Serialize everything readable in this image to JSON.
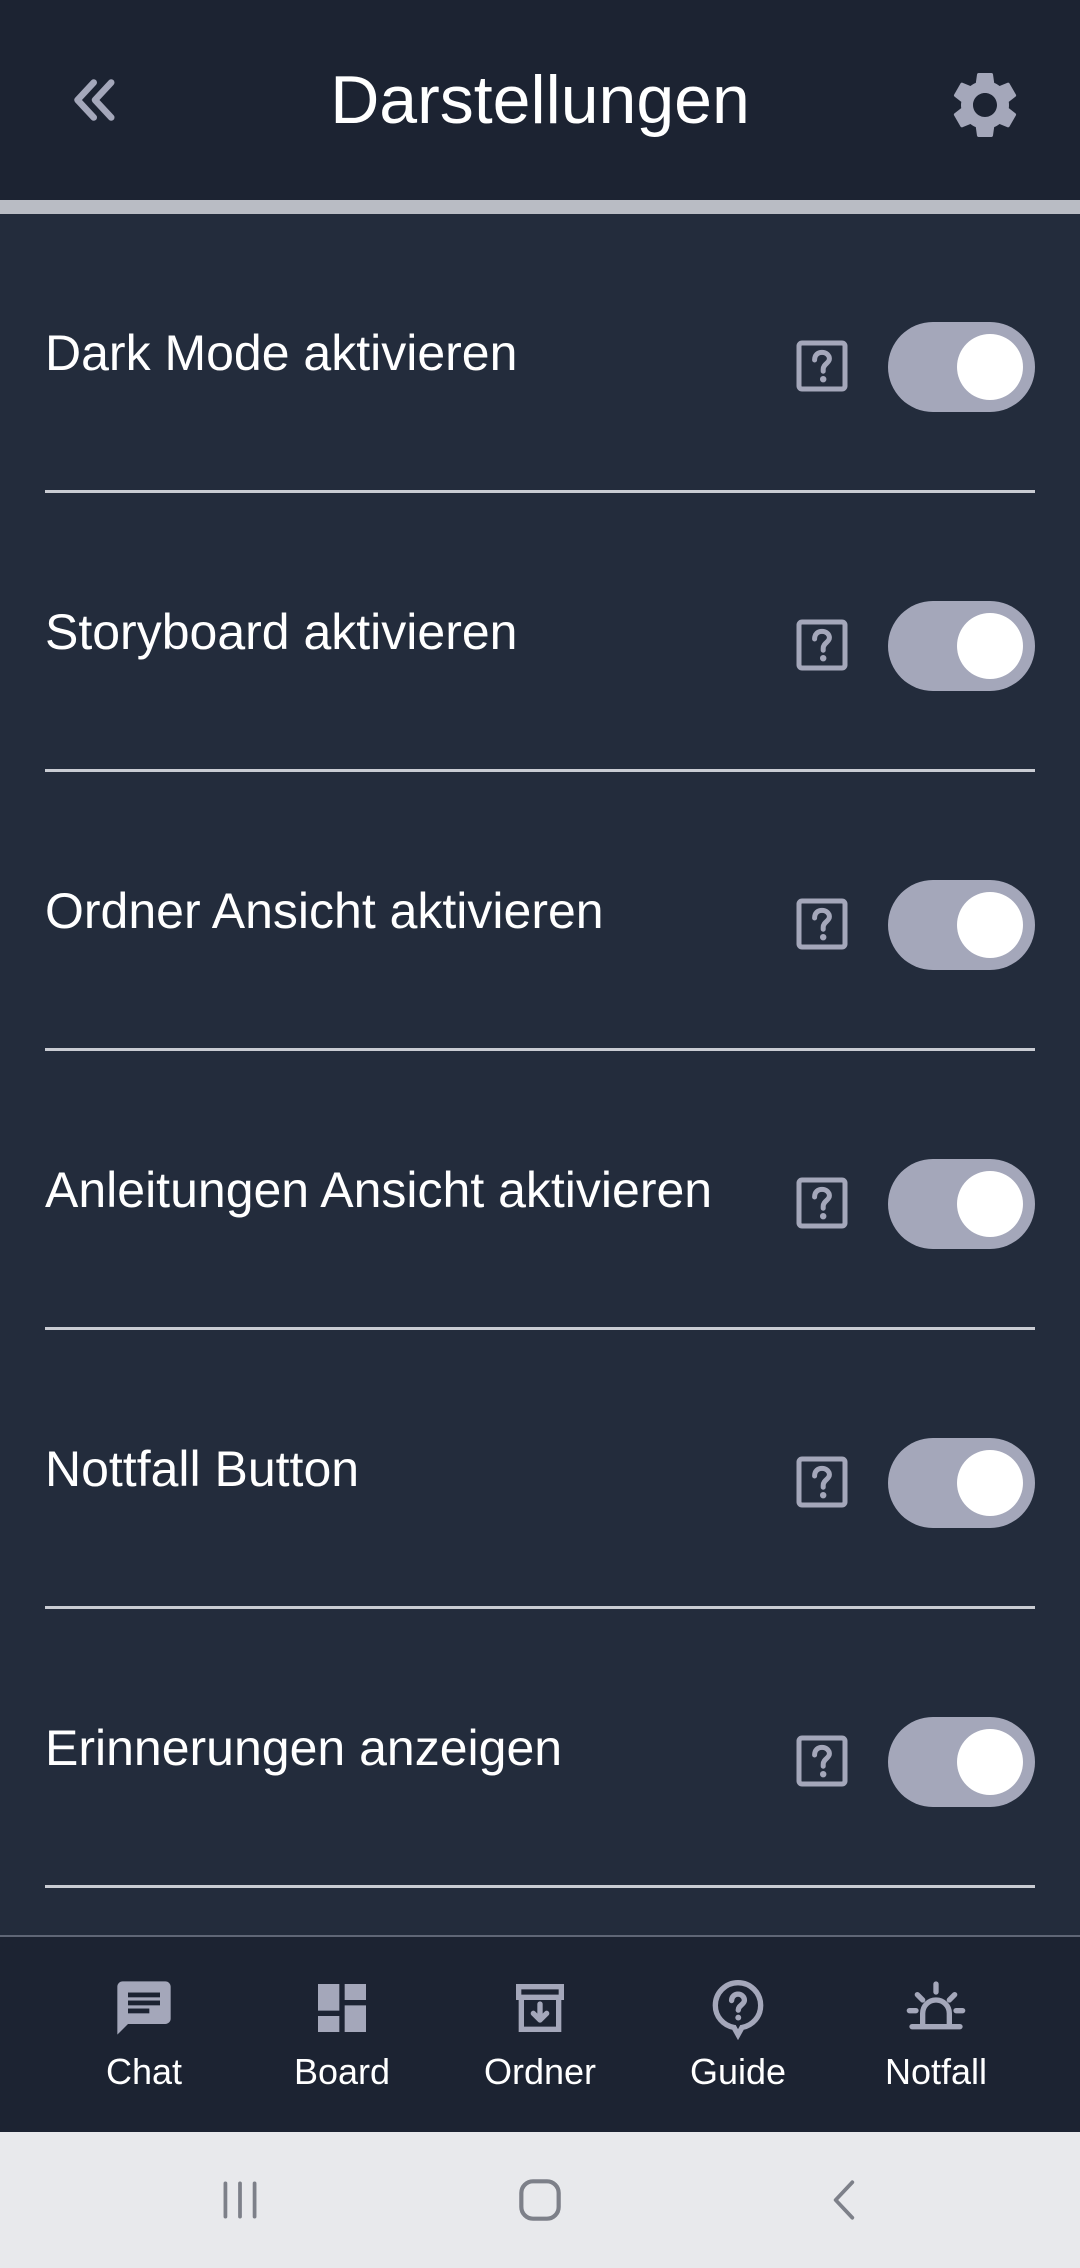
{
  "header": {
    "title": "Darstellungen",
    "back_icon": "double-chevron-left-icon",
    "settings_icon": "gear-icon"
  },
  "colors": {
    "background": "#232c3c",
    "header_background": "#1c2332",
    "toggle_track": "#a4a7ba",
    "toggle_knob": "#ffffff",
    "icon": "#a4a7ba",
    "text": "#ffffff"
  },
  "settings": {
    "items": [
      {
        "label": "Dark Mode aktivieren",
        "enabled": true
      },
      {
        "label": "Storyboard aktivieren",
        "enabled": true
      },
      {
        "label": "Ordner Ansicht aktivieren",
        "enabled": true
      },
      {
        "label": "Anleitungen Ansicht aktivieren",
        "enabled": true
      },
      {
        "label": "Nottfall Button",
        "enabled": true
      },
      {
        "label": "Erinnerungen anzeigen",
        "enabled": true
      }
    ]
  },
  "bottom_nav": {
    "items": [
      {
        "label": "Chat",
        "icon": "chat-icon"
      },
      {
        "label": "Board",
        "icon": "dashboard-icon"
      },
      {
        "label": "Ordner",
        "icon": "archive-icon"
      },
      {
        "label": "Guide",
        "icon": "help-circle-icon"
      },
      {
        "label": "Notfall",
        "icon": "alarm-light-icon"
      }
    ]
  },
  "system_nav": {
    "buttons": [
      "recent-apps-icon",
      "home-icon",
      "back-icon"
    ]
  }
}
